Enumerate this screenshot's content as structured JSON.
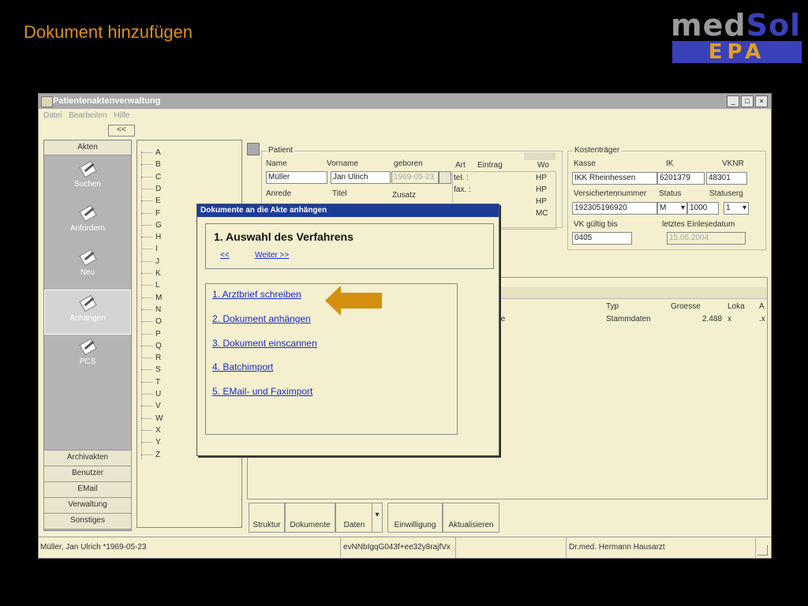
{
  "slide": {
    "title": "Dokument hinzufügen",
    "logo": {
      "med": "med",
      "sol": "Sol",
      "epa": "EPA"
    },
    "accent": "#e0901a"
  },
  "window": {
    "title": "Patientenaktenverwaltung",
    "buttons": [
      "_",
      "□",
      "×"
    ],
    "menu": [
      "Datei",
      "Bearbeiten",
      "Hilfe"
    ],
    "collapse": "<<"
  },
  "nav": {
    "header": "Akten",
    "items": [
      {
        "label": "Suchen",
        "icon": "document-pen-icon"
      },
      {
        "label": "Anfordern",
        "icon": "document-pen-icon"
      },
      {
        "label": "Neu",
        "icon": "document-pen-icon"
      },
      {
        "label": "Anhängen",
        "icon": "document-pen-icon",
        "selected": true
      },
      {
        "label": "PCS",
        "icon": "document-pen-icon"
      }
    ],
    "bottom": [
      "Archivakten",
      "Benutzer",
      "EMail",
      "Verwaltung",
      "Sonstiges"
    ]
  },
  "alphabet": [
    "A",
    "B",
    "C",
    "D",
    "E",
    "F",
    "G",
    "H",
    "I",
    "J",
    "K",
    "L",
    "M",
    "N",
    "O",
    "P",
    "Q",
    "R",
    "S",
    "T",
    "U",
    "V",
    "W",
    "X",
    "Y",
    "Z"
  ],
  "patient": {
    "group": "Patient",
    "name_lbl": "Name",
    "vorname_lbl": "Vorname",
    "geboren_lbl": "geboren",
    "name": "Müller",
    "vorname": "Jan Ulrich",
    "geboren": "1969-05-23",
    "anrede_lbl": "Anrede",
    "titel_lbl": "Titel",
    "zusatz_lbl": "Zusatz",
    "art_lbl": "Art",
    "eintrag_lbl": "Eintrag",
    "wo_lbl": "Wo",
    "tel": "tel. :",
    "fax": "fax. :",
    "wo_values": [
      "HP",
      "HP",
      "HP",
      "MC"
    ]
  },
  "kostentraeger": {
    "group": "Kostenträger",
    "kasse_lbl": "Kasse",
    "ik_lbl": "IK",
    "vknr_lbl": "VKNR",
    "kasse": "IKK Rheinhessen",
    "ik": "6201379",
    "vknr": "48301",
    "vnr_lbl": "Versichertennummer",
    "status_lbl": "Status",
    "statuserg_lbl": "Statuserg",
    "vnr": "192305196920",
    "status": "M",
    "status_num": "1000",
    "statuserg": "1",
    "vk_lbl": "VK gültig bis",
    "einlese_lbl": "letztes Einlesedatum",
    "vk": "0405",
    "einlese": "15.06.2004"
  },
  "documents": {
    "columns": {
      "typ": "Typ",
      "groesse": "Groesse",
      "lokal": "Loka",
      "extra": "A"
    },
    "row": {
      "name_tail": "te",
      "typ": "Stammdaten",
      "groesse": "2.488",
      "lokal": "x",
      "extra": ".x"
    }
  },
  "tabs": [
    "Struktur",
    "Dokumente",
    "Daten",
    "Einwilligung",
    "Aktualisieren"
  ],
  "tab_dropdown": "▾",
  "status": {
    "patient": "Müller, Jan Ulrich *1969-05-23",
    "id": "evNNbIgqG043f+ee32y8rajfVx",
    "doctor": "Dr.med. Hermann Hausarzt"
  },
  "dialog": {
    "title": "Dokumente an die Akte anhängen",
    "heading": "1. Auswahl des Verfahrens",
    "back": "<<",
    "next": "Weiter >>",
    "options": [
      "1. Arztbrief schreiben",
      "2. Dokument anhängen",
      "3. Dokument einscannen",
      "4. Batchimport",
      "5. EMail- und Faximport"
    ]
  },
  "arrow_color": "#d4900e"
}
